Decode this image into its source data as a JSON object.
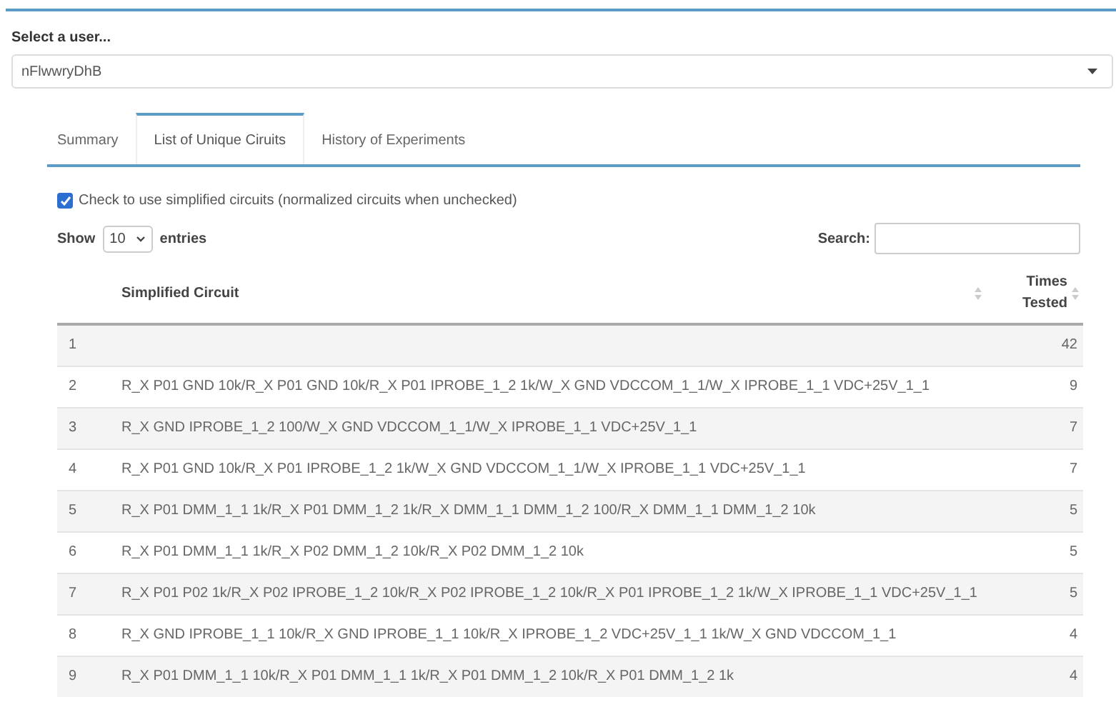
{
  "user_select": {
    "label": "Select a user...",
    "value": "nFlwwryDhB"
  },
  "tabs": [
    {
      "label": "Summary",
      "selected": false
    },
    {
      "label": "List of Unique Ciruits",
      "selected": true
    },
    {
      "label": "History of Experiments",
      "selected": false
    }
  ],
  "simplified_checkbox": {
    "label": "Check to use simplified circuits (normalized circuits when unchecked)",
    "checked": true
  },
  "length_control": {
    "prefix": "Show",
    "value": "10",
    "suffix": "entries"
  },
  "search": {
    "label": "Search:"
  },
  "table": {
    "columns": [
      {
        "label": "Simplified Circuit"
      },
      {
        "label": "Times Tested"
      }
    ],
    "rows": [
      {
        "index": "1",
        "times": "42"
      },
      {
        "index": "2",
        "circuit": "R_X P01 GND 10k/R_X P01 GND 10k/R_X P01 IPROBE_1_2 1k/W_X GND VDCCOM_1_1/W_X IPROBE_1_1 VDC+25V_1_1",
        "times": "9"
      },
      {
        "index": "3",
        "circuit": "R_X GND IPROBE_1_2 100/W_X GND VDCCOM_1_1/W_X IPROBE_1_1 VDC+25V_1_1",
        "times": "7"
      },
      {
        "index": "4",
        "circuit": "R_X P01 GND 10k/R_X P01 IPROBE_1_2 1k/W_X GND VDCCOM_1_1/W_X IPROBE_1_1 VDC+25V_1_1",
        "times": "7"
      },
      {
        "index": "5",
        "circuit": "R_X P01 DMM_1_1 1k/R_X P01 DMM_1_2 1k/R_X DMM_1_1 DMM_1_2 100/R_X DMM_1_1 DMM_1_2 10k",
        "times": "5"
      },
      {
        "index": "6",
        "circuit": "R_X P01 DMM_1_1 1k/R_X P02 DMM_1_2 10k/R_X P02 DMM_1_2 10k",
        "times": "5"
      },
      {
        "index": "7",
        "circuit": "R_X P01 P02 1k/R_X P02 IPROBE_1_2 10k/R_X P02 IPROBE_1_2 10k/R_X P01 IPROBE_1_2 1k/W_X IPROBE_1_1 VDC+25V_1_1",
        "times": "5"
      },
      {
        "index": "8",
        "circuit": "R_X GND IPROBE_1_1 10k/R_X GND IPROBE_1_1 10k/R_X IPROBE_1_2 VDC+25V_1_1 1k/W_X GND VDCCOM_1_1",
        "times": "4"
      },
      {
        "index": "9",
        "circuit": "R_X P01 DMM_1_1 10k/R_X P01 DMM_1_1 1k/R_X P01 DMM_1_2 10k/R_X P01 DMM_1_2 1k",
        "times": "4"
      }
    ]
  }
}
